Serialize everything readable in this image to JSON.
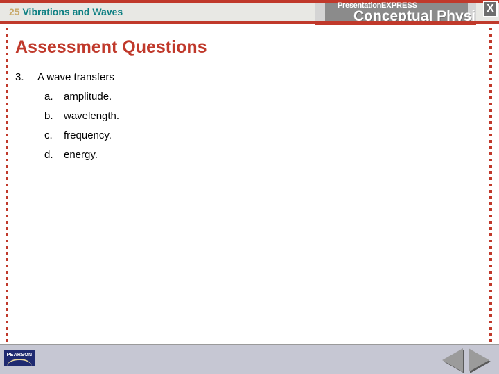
{
  "header": {
    "chapter_number": "25",
    "chapter_title": "Vibrations and Waves",
    "close_label": "X",
    "brand": {
      "line1_light": "Presentation",
      "line1_bold": "EXPRESS",
      "line2": "Conceptual Physics"
    }
  },
  "slide": {
    "title": "Assessment Questions",
    "question": {
      "number": "3.",
      "stem": "A wave transfers",
      "options": [
        {
          "letter": "a.",
          "text": "amplitude."
        },
        {
          "letter": "b.",
          "text": "wavelength."
        },
        {
          "letter": "c.",
          "text": "frequency."
        },
        {
          "letter": "d.",
          "text": "energy."
        }
      ]
    }
  },
  "footer": {
    "publisher": "PEARSON",
    "prev_label": "previous-slide",
    "next_label": "next-slide"
  },
  "colors": {
    "accent_red": "#c0392b",
    "chapter_number": "#c8a96a",
    "chapter_title": "#0d7f82",
    "title_red": "#c0392b",
    "brand_gray": "#8b8b8b",
    "footer_bg": "#c6c7d3",
    "pearson_blue": "#1f2a70"
  }
}
